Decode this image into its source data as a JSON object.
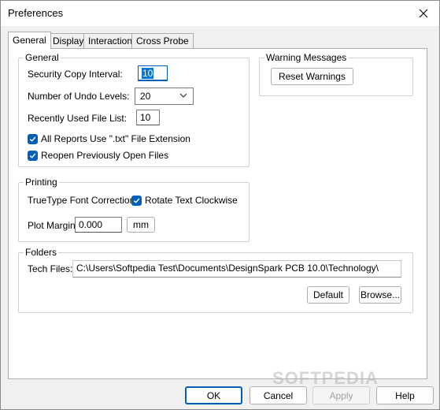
{
  "window": {
    "title": "Preferences"
  },
  "tabs": [
    {
      "label": "General"
    },
    {
      "label": "Display"
    },
    {
      "label": "Interaction"
    },
    {
      "label": "Cross Probe"
    }
  ],
  "general": {
    "group_label": "General",
    "security_copy_label": "Security Copy Interval:",
    "security_copy_value": "10",
    "undo_levels_label": "Number of Undo Levels:",
    "undo_levels_value": "20",
    "recent_files_label": "Recently Used File List:",
    "recent_files_value": "10",
    "txt_extension_label": "All Reports Use \".txt\" File Extension",
    "reopen_files_label": "Reopen Previously Open Files"
  },
  "warnings": {
    "group_label": "Warning Messages",
    "reset_label": "Reset Warnings"
  },
  "printing": {
    "group_label": "Printing",
    "truetype_label": "TrueType Font Correction:",
    "rotate_label": "Rotate Text Clockwise",
    "plot_margin_label": "Plot Margin:",
    "plot_margin_value": "0.000",
    "units_label": "mm"
  },
  "folders": {
    "group_label": "Folders",
    "tech_files_label": "Tech Files:",
    "tech_files_value": "C:\\Users\\Softpedia Test\\Documents\\DesignSpark PCB 10.0\\Technology\\",
    "default_label": "Default",
    "browse_label": "Browse..."
  },
  "footer": {
    "ok_label": "OK",
    "cancel_label": "Cancel",
    "apply_label": "Apply",
    "help_label": "Help"
  },
  "watermark": "SOFTPEDIA",
  "colors": {
    "accent": "#005fb8",
    "selection": "#0078d7"
  }
}
